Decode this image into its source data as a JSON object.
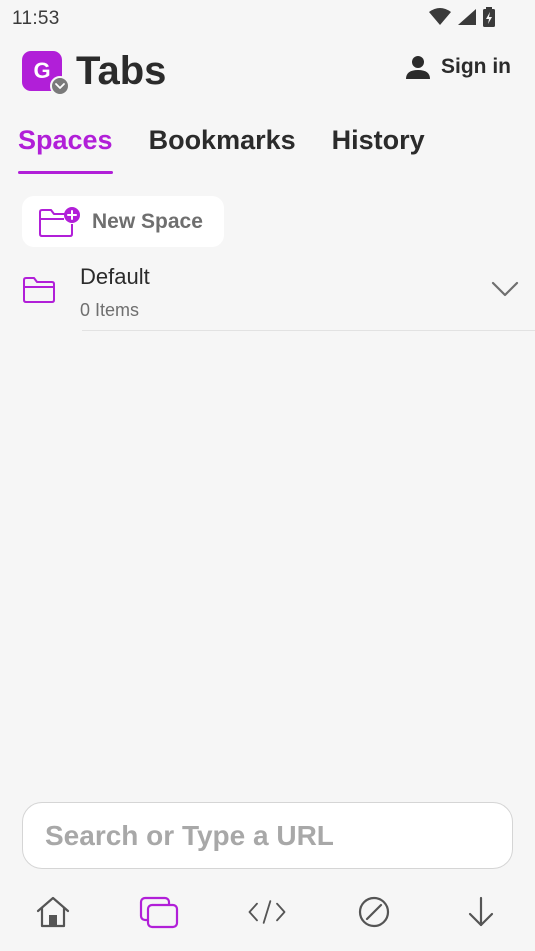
{
  "status_bar": {
    "time": "11:53"
  },
  "header": {
    "avatar_letter": "G",
    "title": "Tabs",
    "sign_in_label": "Sign in"
  },
  "tabs": [
    {
      "label": "Spaces",
      "active": true
    },
    {
      "label": "Bookmarks",
      "active": false
    },
    {
      "label": "History",
      "active": false
    }
  ],
  "new_space": {
    "label": "New Space",
    "icon": "folder-add-icon"
  },
  "spaces": [
    {
      "name": "Default",
      "count_label": "0 Items",
      "icon": "folder-icon"
    }
  ],
  "search": {
    "placeholder": "Search or Type a URL",
    "value": ""
  },
  "bottom_nav": [
    {
      "name": "home",
      "icon": "home-icon",
      "active": false
    },
    {
      "name": "tabs",
      "icon": "tabs-icon",
      "active": true
    },
    {
      "name": "dev-tools",
      "icon": "code-icon",
      "active": false
    },
    {
      "name": "block",
      "icon": "block-icon",
      "active": false
    },
    {
      "name": "downloads",
      "icon": "download-icon",
      "active": false
    }
  ],
  "colors": {
    "accent": "#b11fd8",
    "background": "#f6f6f6",
    "text": "#2b2b2b",
    "muted": "#6f6f6f"
  }
}
